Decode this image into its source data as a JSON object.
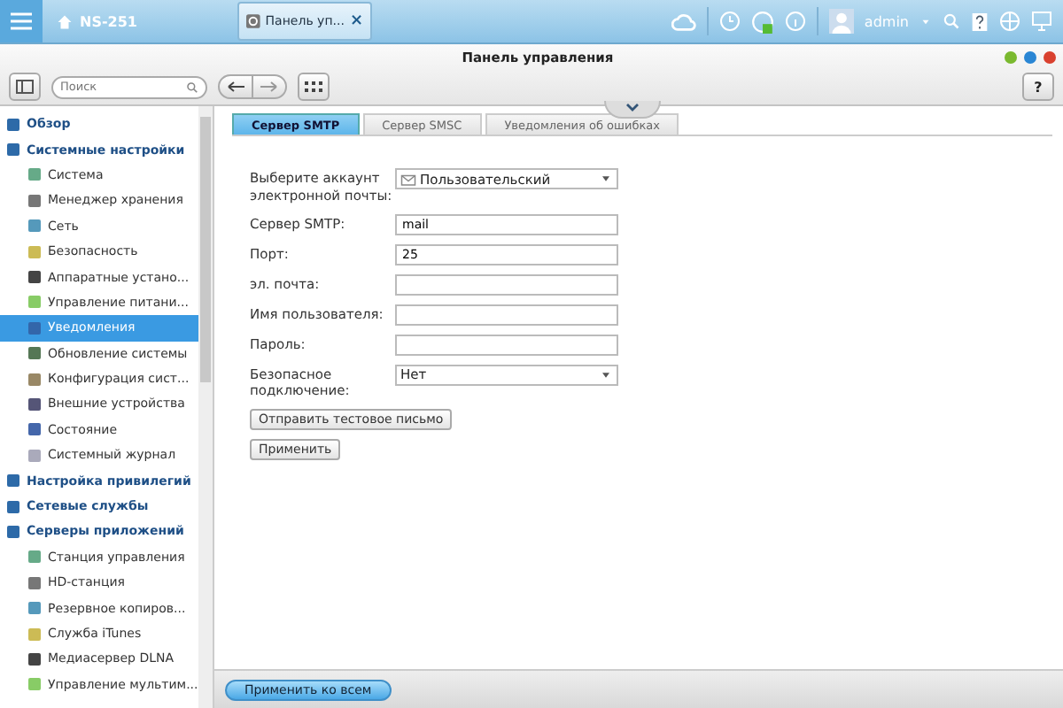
{
  "top_bar": {
    "home_label": "NS-251",
    "app_tab": {
      "label": "Панель уп...",
      "close": "×"
    },
    "user": "admin"
  },
  "window": {
    "title": "Панель управления",
    "search": {
      "placeholder": "Поиск"
    },
    "help": "?"
  },
  "sidebar": {
    "items": [
      {
        "label": "Обзор",
        "selected": false
      },
      {
        "label": "Системные настройки",
        "selected": false,
        "children": [
          {
            "label": "Система",
            "selected": false
          },
          {
            "label": "Менеджер хранения",
            "selected": false
          },
          {
            "label": "Сеть",
            "selected": false
          },
          {
            "label": "Безопасность",
            "selected": false
          },
          {
            "label": "Аппаратные устано...",
            "selected": false
          },
          {
            "label": "Управление питани...",
            "selected": false
          },
          {
            "label": "Уведомления",
            "selected": true
          },
          {
            "label": "Обновление системы",
            "selected": false
          },
          {
            "label": "Конфигурация сист...",
            "selected": false
          },
          {
            "label": "Внешние устройства",
            "selected": false
          },
          {
            "label": "Состояние",
            "selected": false
          },
          {
            "label": "Системный журнал",
            "selected": false
          }
        ]
      },
      {
        "label": "Настройка привилегий",
        "selected": false
      },
      {
        "label": "Сетевые службы",
        "selected": false
      },
      {
        "label": "Серверы приложений",
        "selected": false,
        "children": [
          {
            "label": "Станция управления",
            "selected": false
          },
          {
            "label": "HD-станция",
            "selected": false
          },
          {
            "label": "Резервное копиров...",
            "selected": false
          },
          {
            "label": "Служба iTunes",
            "selected": false
          },
          {
            "label": "Медиасервер DLNA",
            "selected": false
          },
          {
            "label": "Управление мультим...",
            "selected": false
          }
        ]
      }
    ]
  },
  "tabs": [
    {
      "label": "Сервер SMTP",
      "selected": true
    },
    {
      "label": "Сервер SMSC",
      "selected": false
    },
    {
      "label": "Уведомления об ошибках",
      "selected": false
    }
  ],
  "form": {
    "fields": [
      {
        "kind": "select",
        "label": "Выберите аккаунт электронной почты:",
        "value": "Пользовательский",
        "mail_icon": true
      },
      {
        "kind": "text",
        "label": "Сервер SMTP:",
        "value": "mail"
      },
      {
        "kind": "text",
        "label": "Порт:",
        "value": "25"
      },
      {
        "kind": "text",
        "label": "эл. почта:"
      },
      {
        "kind": "text",
        "label": "Имя пользователя:"
      },
      {
        "kind": "text",
        "label": "Пароль:"
      },
      {
        "kind": "select",
        "label": "Безопасное подключение:",
        "value": "Нет",
        "mail_icon": false
      }
    ],
    "test_button": "Отправить тестовое письмо",
    "apply_button": "Применить"
  },
  "footer": {
    "apply_all_button": "Применить ко всем"
  }
}
